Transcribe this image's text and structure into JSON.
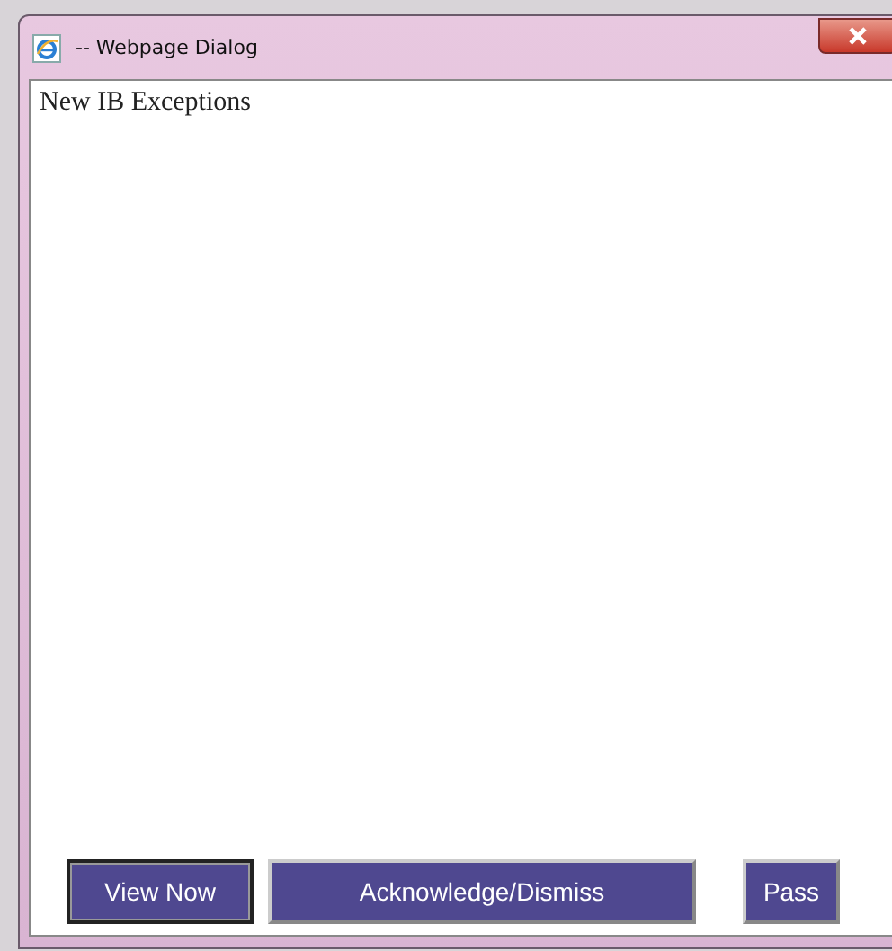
{
  "window": {
    "title": "-- Webpage Dialog"
  },
  "heading": "New IB Exceptions",
  "buttons": [
    {
      "label": "View Now",
      "focused": true
    },
    {
      "label": "Acknowledge/Dismiss",
      "focused": false
    },
    {
      "label": "Pass",
      "focused": false
    }
  ]
}
